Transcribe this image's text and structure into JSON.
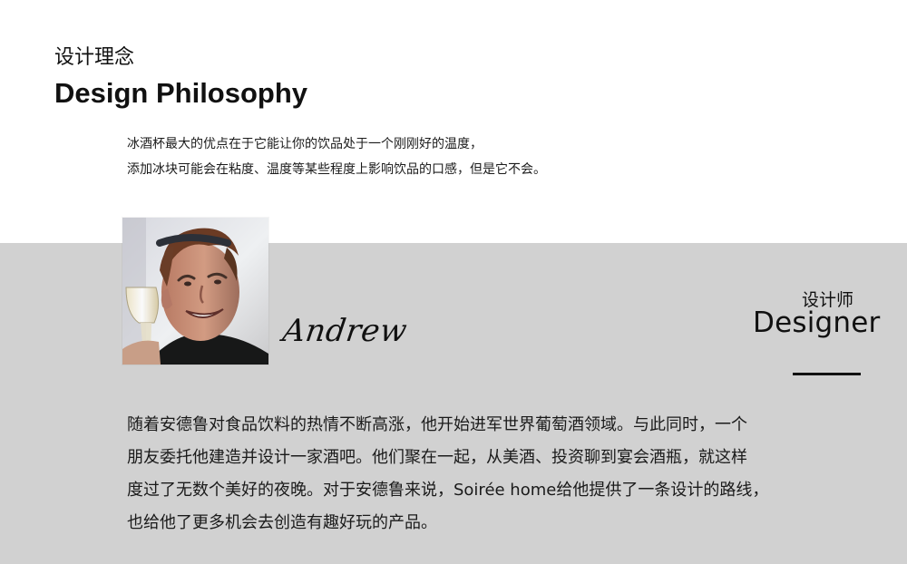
{
  "header": {
    "title_cn": "设计理念",
    "title_en": "Design Philosophy"
  },
  "intro": {
    "line1": "冰酒杯最大的优点在于它能让你的饮品处于一个刚刚好的温度，",
    "line2": "添加冰块可能会在粘度、温度等某些程度上影响饮品的口感，但是它不会。"
  },
  "designer": {
    "signature": "Andrew",
    "label_cn": "设计师",
    "label_en": "Designer"
  },
  "bio": {
    "lines": [
      "随着安德鲁对食品饮料的热情不断高涨，他开始进军世界葡萄酒领域。与此同时，一个",
      "朋友委托他建造并设计一家酒吧。他们聚在一起，从美酒、投资聊到宴会酒瓶，就这样",
      "度过了无数个美好的夜晚。对于安德鲁来说，Soirée home给他提供了一条设计的路线，",
      "也给他了更多机会去创造有趣好玩的产品。"
    ]
  },
  "colors": {
    "top_background": "#ffffff",
    "bottom_background": "#d1d1d1",
    "text": "#1a1a1a"
  }
}
